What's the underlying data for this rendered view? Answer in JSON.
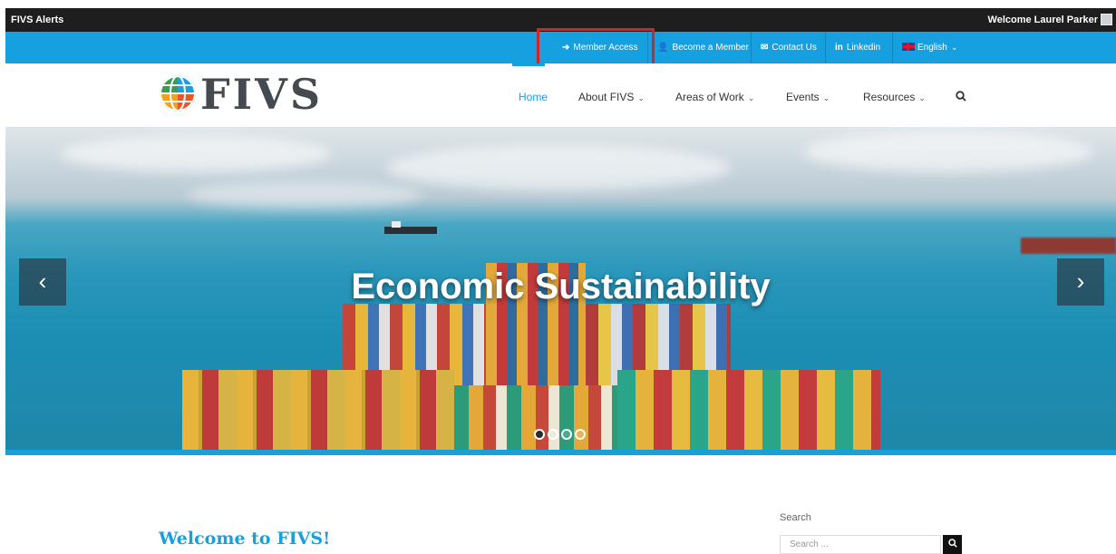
{
  "admin_bar": {
    "alerts_label": "FIVS Alerts",
    "welcome_text": "Welcome Laurel Parker"
  },
  "utility_bar": {
    "items": [
      {
        "label": "Member Access",
        "icon": "sign-in-icon"
      },
      {
        "label": "Become a Member",
        "icon": "user-plus-icon"
      },
      {
        "label": "Contact Us",
        "icon": "envelope-icon"
      },
      {
        "label": "Linkedin",
        "icon": "linkedin-icon"
      },
      {
        "label": "English",
        "icon": "uk-flag-icon"
      }
    ]
  },
  "header": {
    "logo_text": "FIVS",
    "nav": [
      {
        "label": "Home",
        "active": true
      },
      {
        "label": "About FIVS",
        "has_dropdown": true
      },
      {
        "label": "Areas of Work",
        "has_dropdown": true
      },
      {
        "label": "Events",
        "has_dropdown": true
      },
      {
        "label": "Resources",
        "has_dropdown": true
      }
    ]
  },
  "hero": {
    "title": "Economic Sustainability",
    "slide_count": 4,
    "active_slide": 1
  },
  "content": {
    "heading": "Welcome to FIVS!"
  },
  "sidebar": {
    "search_label": "Search",
    "search_placeholder": "Search ..."
  },
  "colors": {
    "accent": "#16a0e0",
    "admin_bar": "#1e1e1e",
    "highlight": "#d1232a"
  }
}
